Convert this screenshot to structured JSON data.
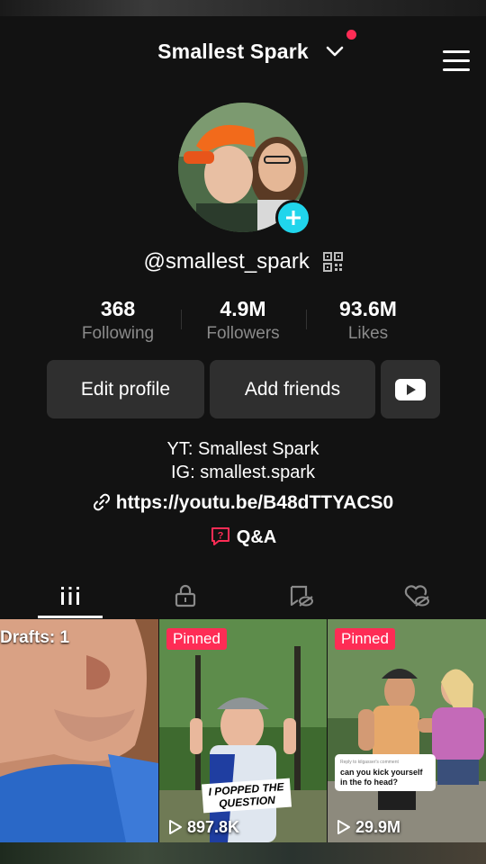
{
  "header": {
    "account_name": "Smallest Spark",
    "has_notification": true
  },
  "profile": {
    "username": "@smallest_spark",
    "stats": [
      {
        "value": "368",
        "label": "Following"
      },
      {
        "value": "4.9M",
        "label": "Followers"
      },
      {
        "value": "93.6M",
        "label": "Likes"
      }
    ],
    "buttons": {
      "edit": "Edit profile",
      "add_friends": "Add friends"
    },
    "bio": {
      "line1": "YT: Smallest Spark",
      "line2": "IG: smallest.spark"
    },
    "link": "https://youtu.be/B48dTTYACS0",
    "qa_label": "Q&A"
  },
  "tabs": [
    "videos-grid-icon",
    "private-lock-icon",
    "saved-icon",
    "liked-icon"
  ],
  "videos": [
    {
      "type": "drafts",
      "label": "Drafts: 1"
    },
    {
      "type": "pinned",
      "badge": "Pinned",
      "overlay": "I POPPED THE QUESTION",
      "views": "897.8K"
    },
    {
      "type": "pinned",
      "badge": "Pinned",
      "comment_header": "Reply to kilgasser's comment",
      "comment": "can you kick yourself in the fo head?",
      "views": "29.9M"
    }
  ],
  "colors": {
    "background": "#121212",
    "accent_red": "#fe2c55",
    "accent_cyan": "#20d5ec",
    "button_bg": "#2f2f2f"
  }
}
